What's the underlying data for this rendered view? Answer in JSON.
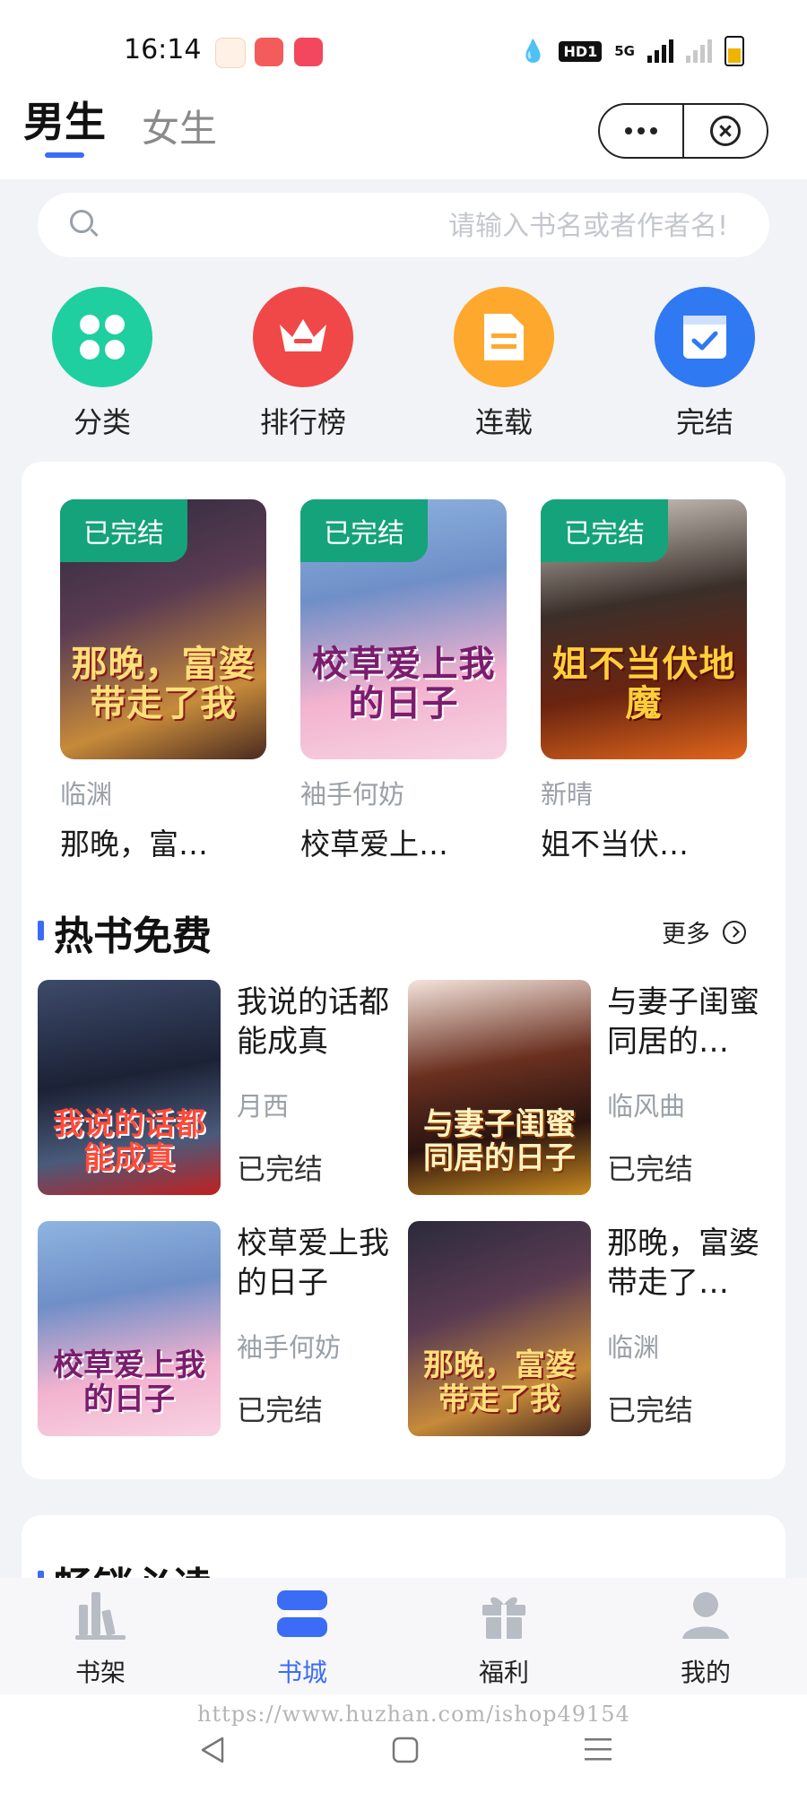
{
  "status_bar": {
    "time": "16:14",
    "hd": "HD1",
    "network": "5G"
  },
  "header": {
    "tab_male": "男生",
    "tab_female": "女生"
  },
  "search": {
    "placeholder": "请输入书名或者作者名!"
  },
  "categories": [
    {
      "label": "分类",
      "color": "#1fcfa0",
      "icon": "grid-icon"
    },
    {
      "label": "排行榜",
      "color": "#f04848",
      "icon": "crown-icon"
    },
    {
      "label": "连载",
      "color": "#ffa82e",
      "icon": "document-icon"
    },
    {
      "label": "完结",
      "color": "#2f79f3",
      "icon": "calendar-check-icon"
    }
  ],
  "completed_books": [
    {
      "badge": "已完结",
      "author": "临渊",
      "title": "那晚，富…",
      "cover_text": "那晚，富婆带走了我"
    },
    {
      "badge": "已完结",
      "author": "袖手何妨",
      "title": "校草爱上…",
      "cover_text": "校草爱上我的日子"
    },
    {
      "badge": "已完结",
      "author": "新晴",
      "title": "姐不当伏…",
      "cover_text": "姐不当伏地魔"
    }
  ],
  "hot_free": {
    "title": "热书免费",
    "more": "更多",
    "books": [
      {
        "title": "我说的话都能成真",
        "author": "月西",
        "status": "已完结",
        "cover_text": "我说的话都能成真"
      },
      {
        "title": "与妻子闺蜜同居的…",
        "author": "临风曲",
        "status": "已完结",
        "cover_text": "与妻子闺蜜同居的日子"
      },
      {
        "title": "校草爱上我的日子",
        "author": "袖手何妨",
        "status": "已完结",
        "cover_text": "校草爱上我的日子"
      },
      {
        "title": "那晚，富婆带走了…",
        "author": "临渊",
        "status": "已完结",
        "cover_text": "那晚，富婆带走了我"
      }
    ]
  },
  "next_section": {
    "title": "畅销必读"
  },
  "bottom_nav": [
    {
      "label": "书架",
      "icon": "bookshelf-icon"
    },
    {
      "label": "书城",
      "icon": "bookstore-icon"
    },
    {
      "label": "福利",
      "icon": "gift-icon"
    },
    {
      "label": "我的",
      "icon": "profile-icon"
    }
  ],
  "watermark": "https://www.huzhan.com/ishop49154",
  "colors": {
    "accent": "#3b6cf6",
    "completed_badge": "#14a37a",
    "muted_text": "#9aa0a8"
  }
}
